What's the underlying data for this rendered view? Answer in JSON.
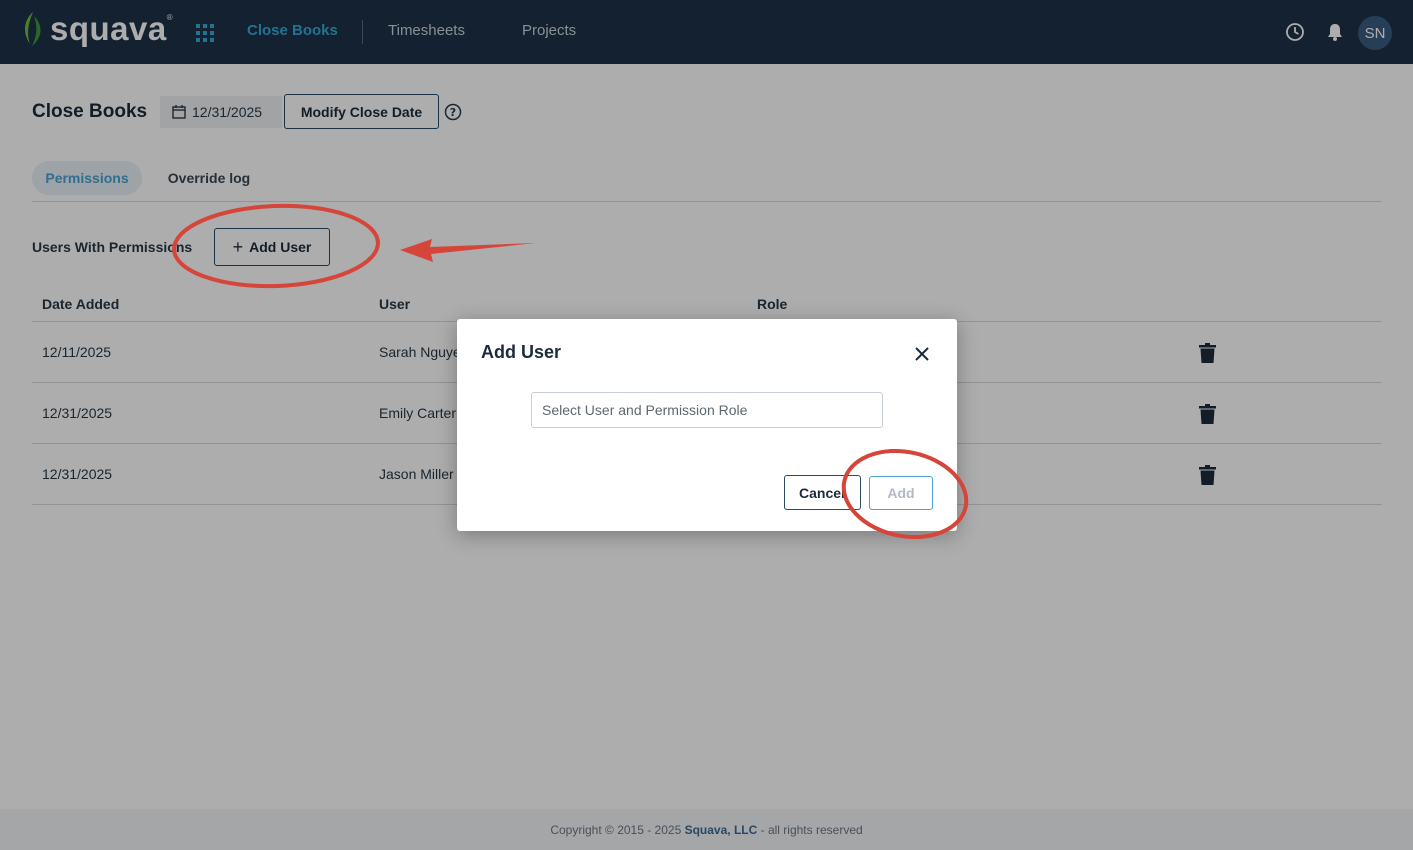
{
  "header": {
    "brand": "squava",
    "brand_mark": "®",
    "nav": [
      {
        "label": "Close Books",
        "active": true
      },
      {
        "label": "Timesheets",
        "active": false
      },
      {
        "label": "Projects",
        "active": false
      }
    ],
    "avatar_initials": "SN",
    "icons": [
      "apps-grid-icon",
      "clock-icon",
      "bell-icon"
    ]
  },
  "page": {
    "title": "Close Books",
    "close_date": "12/31/2025",
    "modify_button": "Modify Close Date",
    "tabs": [
      {
        "label": "Permissions",
        "active": true
      },
      {
        "label": "Override log",
        "active": false
      }
    ],
    "section_label": "Users With Permissions",
    "add_user_button": "Add User"
  },
  "table": {
    "columns": [
      "Date Added",
      "User",
      "Role"
    ],
    "rows": [
      {
        "date": "12/11/2025",
        "user": "Sarah Nguyen"
      },
      {
        "date": "12/31/2025",
        "user": "Emily Carter"
      },
      {
        "date": "12/31/2025",
        "user": "Jason Miller"
      }
    ]
  },
  "modal": {
    "title": "Add User",
    "select_placeholder": "Select User and Permission Role",
    "cancel_button": "Cancel",
    "add_button": "Add"
  },
  "footer": {
    "prefix": "Copyright © 2015 - 2025 ",
    "company": "Squava, LLC",
    "suffix": " - all rights reserved"
  },
  "colors": {
    "header_bg": "#1c3147",
    "accent": "#36a9d8",
    "annotation_red": "#d6453a"
  }
}
